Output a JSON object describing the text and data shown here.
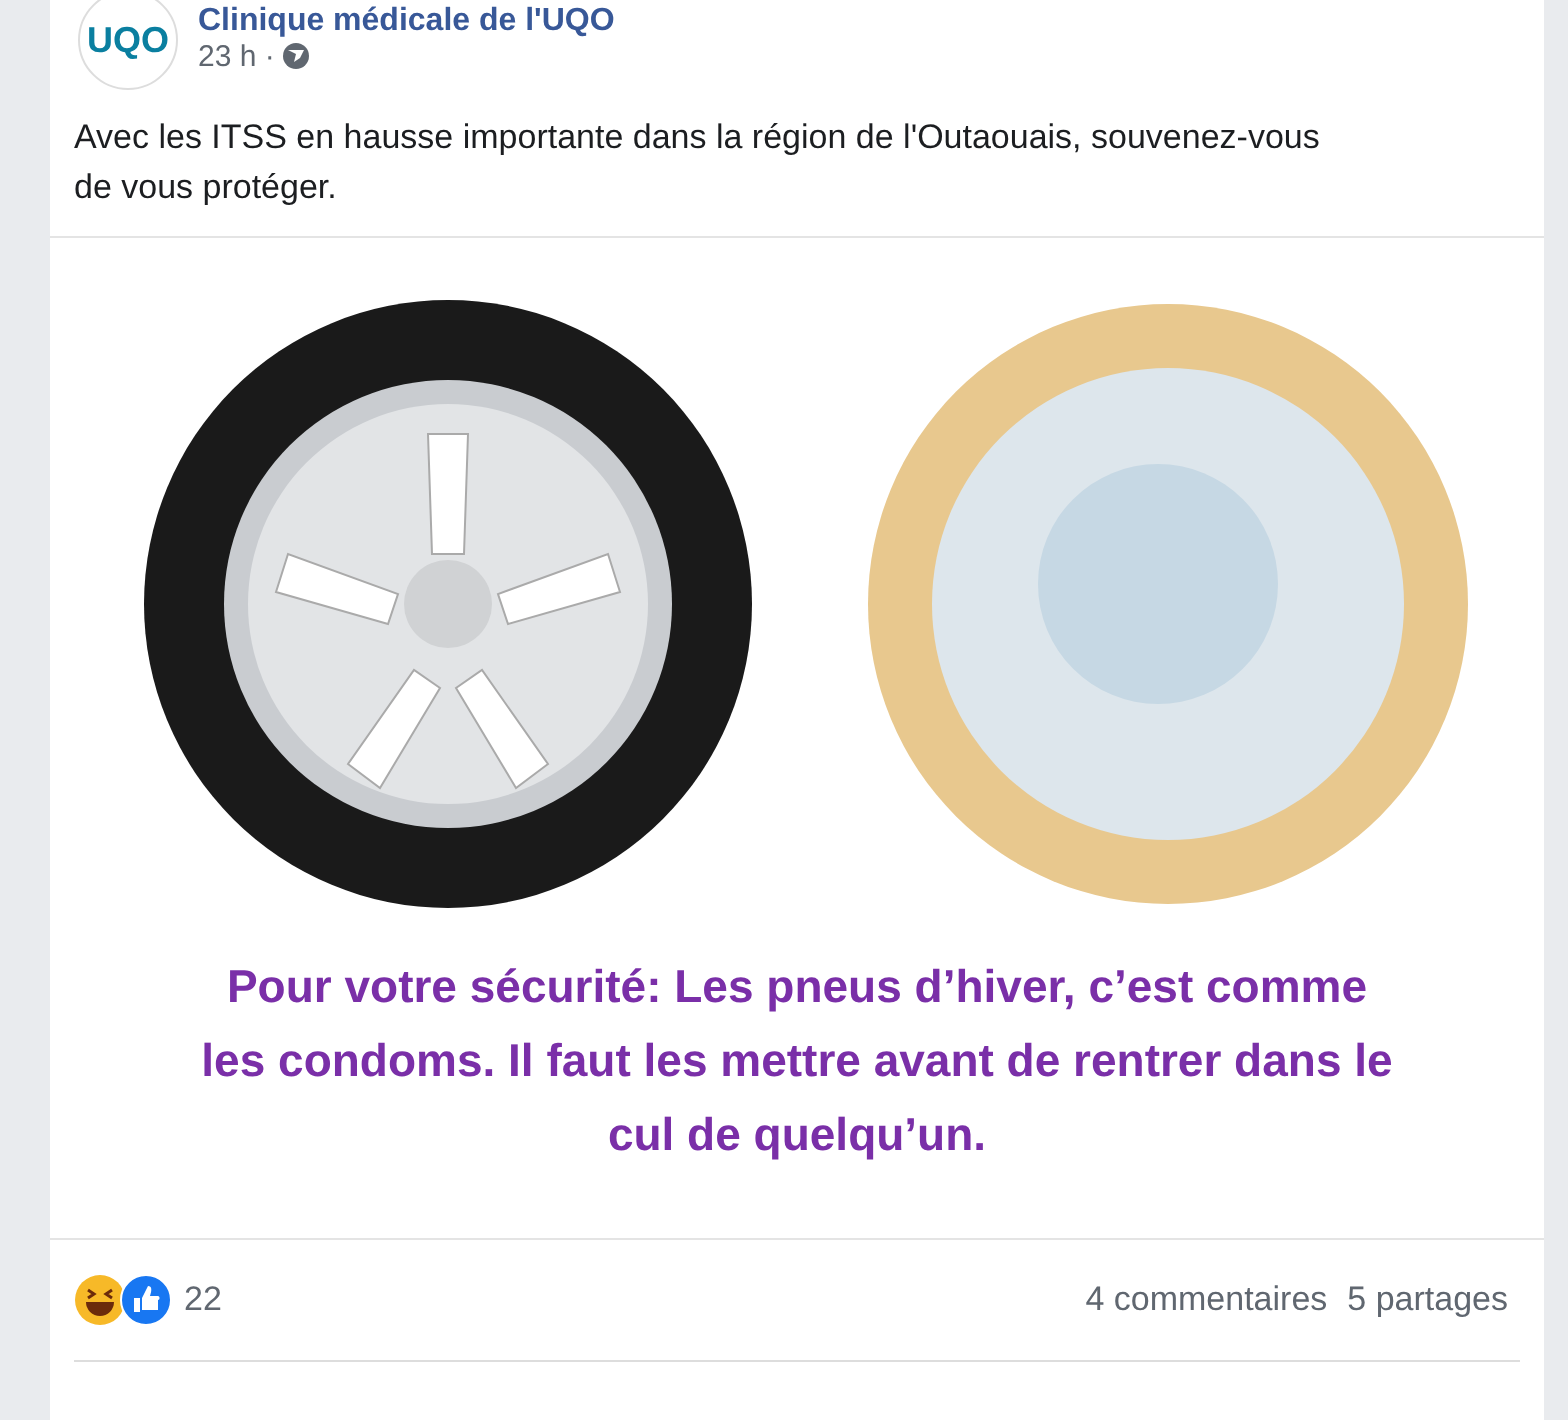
{
  "post": {
    "logo_text": "UQO",
    "author": "Clinique médicale de l'UQO",
    "time": "23 h ·",
    "text": "Avec les ITSS en hausse importante dans la région de l'Outaouais, souvenez-vous de vous protéger."
  },
  "image": {
    "caption": "Pour votre sécurité: Les pneus d’hiver, c’est comme les condoms. Il faut les mettre avant de rentrer dans le cul de quelqu’un."
  },
  "footer": {
    "reaction_count": "22",
    "comments": "4 commentaires",
    "shares": "5 partages"
  }
}
